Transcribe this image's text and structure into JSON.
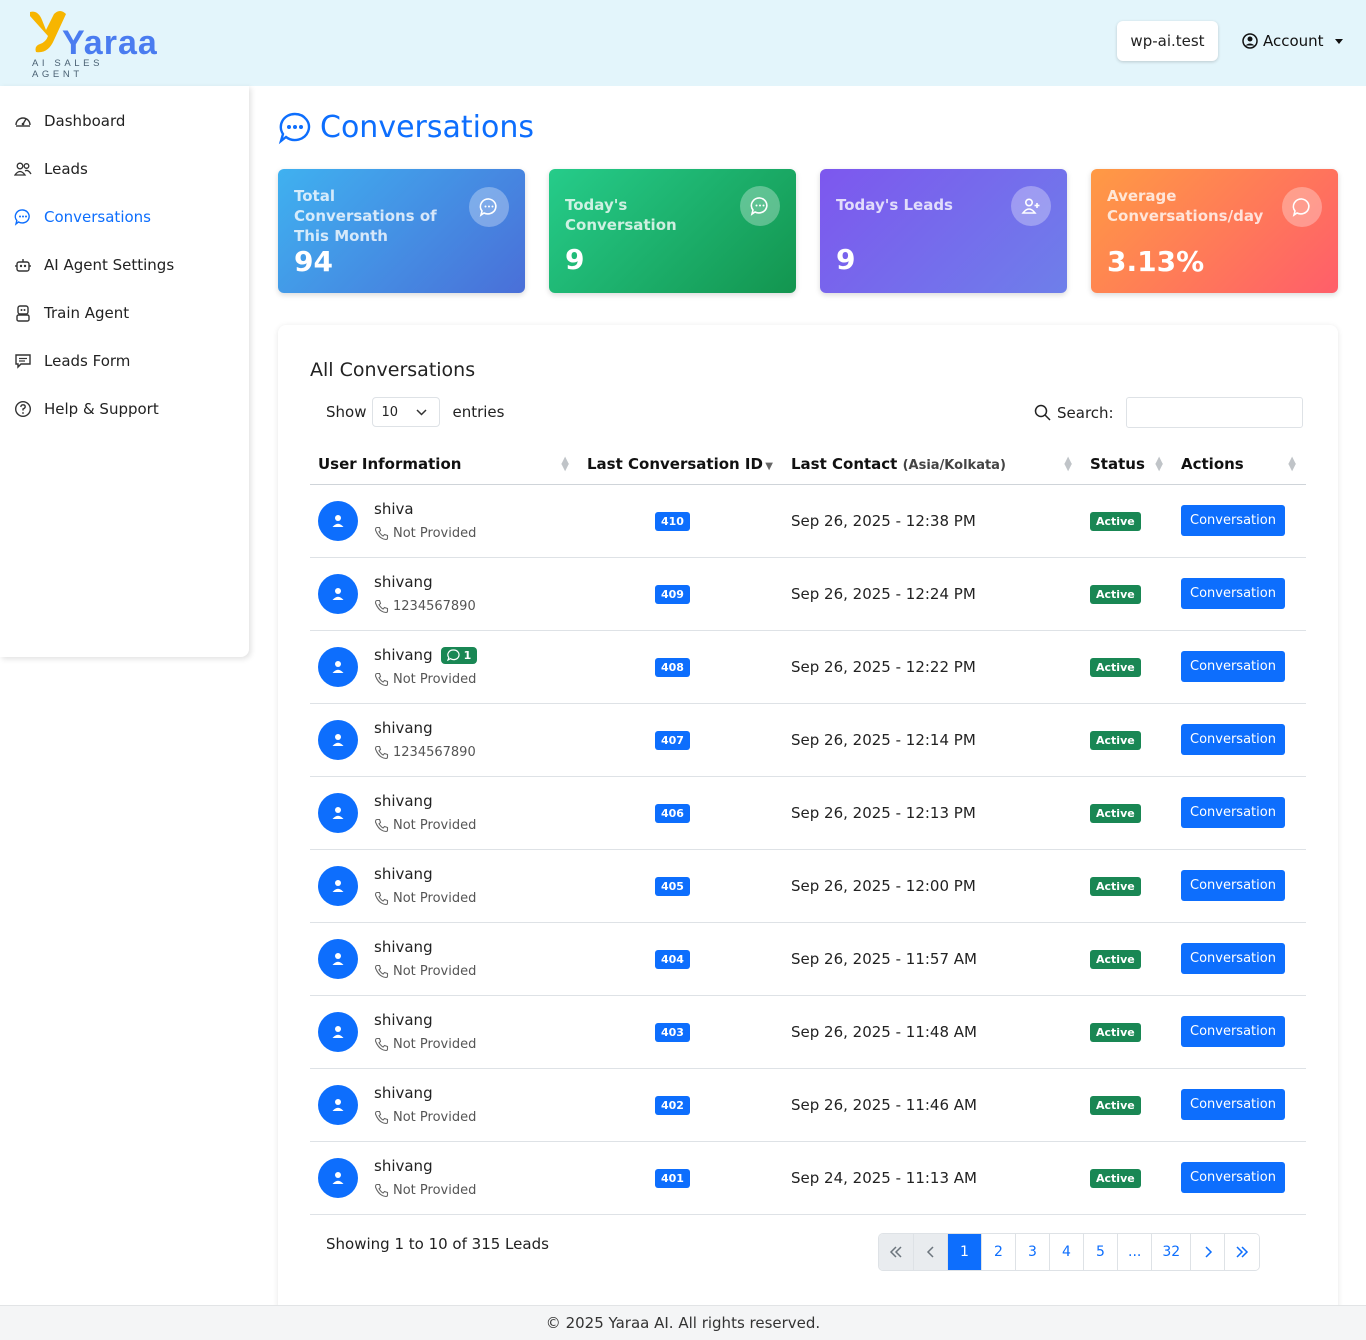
{
  "brand": {
    "name": "Yaraa",
    "tagline": "AI SALES AGENT",
    "accent": "#0d6efd"
  },
  "header": {
    "site": "wp-ai.test",
    "account_label": "Account"
  },
  "sidebar": {
    "items": [
      {
        "label": "Dashboard",
        "icon": "dashboard-icon"
      },
      {
        "label": "Leads",
        "icon": "users-icon"
      },
      {
        "label": "Conversations",
        "icon": "chat-icon",
        "active": true
      },
      {
        "label": "AI Agent Settings",
        "icon": "robot-icon"
      },
      {
        "label": "Train Agent",
        "icon": "robot-train-icon"
      },
      {
        "label": "Leads Form",
        "icon": "form-icon"
      },
      {
        "label": "Help & Support",
        "icon": "help-icon"
      }
    ]
  },
  "page": {
    "title": "Conversations"
  },
  "stats": [
    {
      "label": "Total Conversations of This Month",
      "value": "94"
    },
    {
      "label": "Today's Conversation",
      "value": "9"
    },
    {
      "label": "Today's Leads",
      "value": "9"
    },
    {
      "label": "Average Conversations/day",
      "value": "3.13%"
    }
  ],
  "table": {
    "title": "All Conversations",
    "show_label": "Show",
    "entries_value": "10",
    "entries_label": "entries",
    "search_label": "Search:",
    "search_value": "",
    "columns": {
      "user": "User Information",
      "id": "Last Conversation ID",
      "contact": "Last Contact",
      "contact_tz": "(Asia/Kolkata)",
      "status": "Status",
      "actions": "Actions"
    },
    "action_label": "Conversation",
    "rows": [
      {
        "name": "shiva",
        "phone": "Not Provided",
        "id": "410",
        "contact": "Sep 26, 2025 - 12:38 PM",
        "status": "Active"
      },
      {
        "name": "shivang",
        "phone": "1234567890",
        "id": "409",
        "contact": "Sep 26, 2025 - 12:24 PM",
        "status": "Active"
      },
      {
        "name": "shivang",
        "phone": "Not Provided",
        "id": "408",
        "contact": "Sep 26, 2025 - 12:22 PM",
        "status": "Active",
        "unread": "1"
      },
      {
        "name": "shivang",
        "phone": "1234567890",
        "id": "407",
        "contact": "Sep 26, 2025 - 12:14 PM",
        "status": "Active"
      },
      {
        "name": "shivang",
        "phone": "Not Provided",
        "id": "406",
        "contact": "Sep 26, 2025 - 12:13 PM",
        "status": "Active"
      },
      {
        "name": "shivang",
        "phone": "Not Provided",
        "id": "405",
        "contact": "Sep 26, 2025 - 12:00 PM",
        "status": "Active"
      },
      {
        "name": "shivang",
        "phone": "Not Provided",
        "id": "404",
        "contact": "Sep 26, 2025 - 11:57 AM",
        "status": "Active"
      },
      {
        "name": "shivang",
        "phone": "Not Provided",
        "id": "403",
        "contact": "Sep 26, 2025 - 11:48 AM",
        "status": "Active"
      },
      {
        "name": "shivang",
        "phone": "Not Provided",
        "id": "402",
        "contact": "Sep 26, 2025 - 11:46 AM",
        "status": "Active"
      },
      {
        "name": "shivang",
        "phone": "Not Provided",
        "id": "401",
        "contact": "Sep 24, 2025 - 11:13 AM",
        "status": "Active"
      }
    ],
    "info": "Showing 1 to 10 of 315 Leads",
    "pagination": [
      "1",
      "2",
      "3",
      "4",
      "5",
      "...",
      "32"
    ],
    "current_page": "1"
  },
  "footer": {
    "text": "© 2025 Yaraa AI. All rights reserved."
  }
}
